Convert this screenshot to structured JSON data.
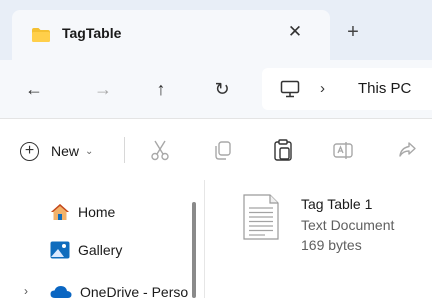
{
  "tab": {
    "title": "TagTable",
    "close_symbol": "✕",
    "new_tab_symbol": "+"
  },
  "nav": {
    "back": "←",
    "forward": "→",
    "up": "↑",
    "refresh": "↻",
    "address": {
      "chevron": "›",
      "location": "This PC"
    }
  },
  "commandbar": {
    "new_label": "New",
    "new_chevron": "⌄"
  },
  "sidebar": {
    "items": [
      {
        "label": "Home",
        "icon": "home-icon"
      },
      {
        "label": "Gallery",
        "icon": "gallery-icon"
      },
      {
        "label": "OneDrive - Perso",
        "icon": "onedrive-icon"
      }
    ],
    "expander": "›"
  },
  "file": {
    "name": "Tag Table 1",
    "type": "Text Document",
    "size": "169 bytes"
  },
  "colors": {
    "tabstrip_bg": "#e8eef7",
    "folder_yellow": "#f4c032",
    "accent_blue": "#0f6cbd",
    "onedrive_blue": "#0a66c2"
  }
}
